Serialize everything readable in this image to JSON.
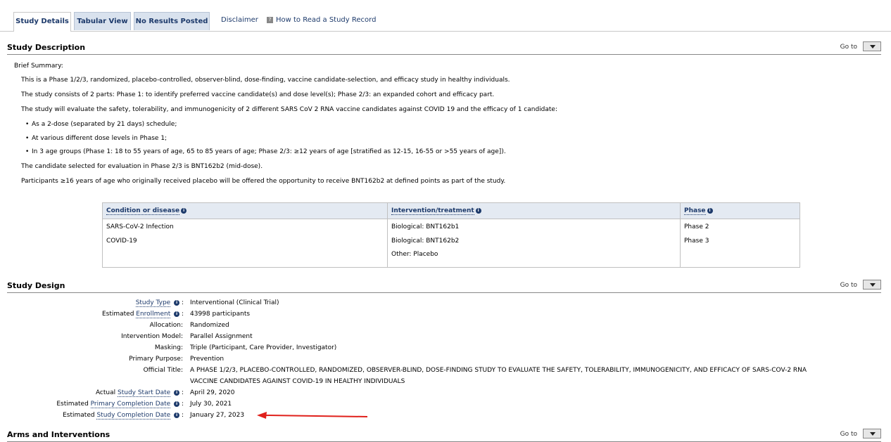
{
  "tabs": {
    "study_details": "Study Details",
    "tabular_view": "Tabular View",
    "no_results": "No Results Posted",
    "disclaimer": "Disclaimer",
    "how_to_read": "How to Read a Study Record"
  },
  "goto_label": "Go to",
  "description": {
    "title": "Study Description",
    "brief_summary_label": "Brief Summary:",
    "p1": "This is a Phase 1/2/3, randomized, placebo-controlled, observer-blind, dose-finding, vaccine candidate-selection, and efficacy study in healthy individuals.",
    "p2": "The study consists of 2 parts: Phase 1: to identify preferred vaccine candidate(s) and dose level(s); Phase 2/3: an expanded cohort and efficacy part.",
    "p3": "The study will evaluate the safety, tolerability, and immunogenicity of 2 different SARS CoV 2 RNA vaccine candidates against COVID 19 and the efficacy of 1 candidate:",
    "bullets": [
      "As a 2-dose (separated by 21 days) schedule;",
      "At various different dose levels in Phase 1;",
      "In 3 age groups (Phase 1: 18 to 55 years of age, 65 to 85 years of age; Phase 2/3: ≥12 years of age [stratified as 12-15, 16-55 or >55 years of age])."
    ],
    "p4": "The candidate selected for evaluation in Phase 2/3 is BNT162b2 (mid-dose).",
    "p5": "Participants ≥16 years of age who originally received placebo will be offered the opportunity to receive BNT162b2 at defined points as part of the study."
  },
  "conditions_table": {
    "headers": [
      "Condition or disease",
      "Intervention/treatment",
      "Phase"
    ],
    "conditions": [
      "SARS-CoV-2 Infection",
      "COVID-19"
    ],
    "interventions": [
      "Biological: BNT162b1",
      "Biological: BNT162b2",
      "Other: Placebo"
    ],
    "phases": [
      "Phase 2",
      "Phase 3"
    ]
  },
  "design": {
    "title": "Study Design",
    "rows": [
      {
        "prefix": "",
        "term": "Study Type",
        "value": "Interventional  (Clinical Trial)"
      },
      {
        "prefix": "Estimated ",
        "term": "Enrollment",
        "value": "43998 participants"
      },
      {
        "prefix": "Allocation:",
        "term": "",
        "value": "Randomized"
      },
      {
        "prefix": "Intervention Model:",
        "term": "",
        "value": "Parallel Assignment"
      },
      {
        "prefix": "Masking:",
        "term": "",
        "value": "Triple (Participant, Care Provider, Investigator)"
      },
      {
        "prefix": "Primary Purpose:",
        "term": "",
        "value": "Prevention"
      },
      {
        "prefix": "Official Title:",
        "term": "",
        "value": "A PHASE 1/2/3, PLACEBO-CONTROLLED, RANDOMIZED, OBSERVER-BLIND, DOSE-FINDING STUDY TO EVALUATE THE SAFETY, TOLERABILITY, IMMUNOGENICITY, AND EFFICACY OF SARS-COV-2 RNA"
      },
      {
        "prefix": "",
        "term": "",
        "value": "VACCINE CANDIDATES AGAINST COVID-19 IN HEALTHY INDIVIDUALS"
      },
      {
        "prefix": "Actual ",
        "term": "Study Start Date",
        "value": "April 29, 2020"
      },
      {
        "prefix": "Estimated ",
        "term": "Primary Completion Date",
        "value": "July 30, 2021"
      },
      {
        "prefix": "Estimated ",
        "term": "Study Completion Date",
        "value": "January 27, 2023"
      }
    ]
  },
  "arms": {
    "title": "Arms and Interventions"
  },
  "colors": {
    "accent": "#1d3a6b",
    "tab_bg": "#d9e2ee",
    "arrow": "#e0201b"
  }
}
